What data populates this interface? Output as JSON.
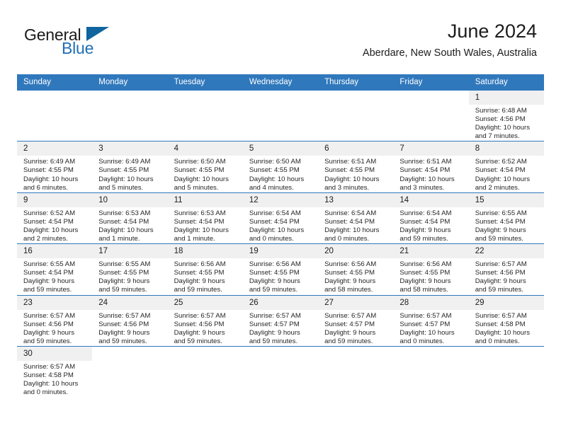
{
  "brand": {
    "name_top": "General",
    "name_bottom": "Blue",
    "accent_color": "#10659f",
    "blue_text_color": "#1f6fb5"
  },
  "header": {
    "title": "June 2024",
    "location": "Aberdare, New South Wales, Australia"
  },
  "theme": {
    "header_row_bg": "#3078bc",
    "day_number_bg": "#f0f0f0",
    "grid_line": "#7c7c7c",
    "week_divider": "#3078bc"
  },
  "weekdays": [
    "Sunday",
    "Monday",
    "Tuesday",
    "Wednesday",
    "Thursday",
    "Friday",
    "Saturday"
  ],
  "weeks": [
    [
      {
        "day": "",
        "empty": true
      },
      {
        "day": "",
        "empty": true
      },
      {
        "day": "",
        "empty": true
      },
      {
        "day": "",
        "empty": true
      },
      {
        "day": "",
        "empty": true
      },
      {
        "day": "",
        "empty": true
      },
      {
        "day": "1",
        "sunrise": "Sunrise: 6:48 AM",
        "sunset": "Sunset: 4:56 PM",
        "daylight1": "Daylight: 10 hours",
        "daylight2": "and 7 minutes."
      }
    ],
    [
      {
        "day": "2",
        "sunrise": "Sunrise: 6:49 AM",
        "sunset": "Sunset: 4:55 PM",
        "daylight1": "Daylight: 10 hours",
        "daylight2": "and 6 minutes."
      },
      {
        "day": "3",
        "sunrise": "Sunrise: 6:49 AM",
        "sunset": "Sunset: 4:55 PM",
        "daylight1": "Daylight: 10 hours",
        "daylight2": "and 5 minutes."
      },
      {
        "day": "4",
        "sunrise": "Sunrise: 6:50 AM",
        "sunset": "Sunset: 4:55 PM",
        "daylight1": "Daylight: 10 hours",
        "daylight2": "and 5 minutes."
      },
      {
        "day": "5",
        "sunrise": "Sunrise: 6:50 AM",
        "sunset": "Sunset: 4:55 PM",
        "daylight1": "Daylight: 10 hours",
        "daylight2": "and 4 minutes."
      },
      {
        "day": "6",
        "sunrise": "Sunrise: 6:51 AM",
        "sunset": "Sunset: 4:55 PM",
        "daylight1": "Daylight: 10 hours",
        "daylight2": "and 3 minutes."
      },
      {
        "day": "7",
        "sunrise": "Sunrise: 6:51 AM",
        "sunset": "Sunset: 4:54 PM",
        "daylight1": "Daylight: 10 hours",
        "daylight2": "and 3 minutes."
      },
      {
        "day": "8",
        "sunrise": "Sunrise: 6:52 AM",
        "sunset": "Sunset: 4:54 PM",
        "daylight1": "Daylight: 10 hours",
        "daylight2": "and 2 minutes."
      }
    ],
    [
      {
        "day": "9",
        "sunrise": "Sunrise: 6:52 AM",
        "sunset": "Sunset: 4:54 PM",
        "daylight1": "Daylight: 10 hours",
        "daylight2": "and 2 minutes."
      },
      {
        "day": "10",
        "sunrise": "Sunrise: 6:53 AM",
        "sunset": "Sunset: 4:54 PM",
        "daylight1": "Daylight: 10 hours",
        "daylight2": "and 1 minute."
      },
      {
        "day": "11",
        "sunrise": "Sunrise: 6:53 AM",
        "sunset": "Sunset: 4:54 PM",
        "daylight1": "Daylight: 10 hours",
        "daylight2": "and 1 minute."
      },
      {
        "day": "12",
        "sunrise": "Sunrise: 6:54 AM",
        "sunset": "Sunset: 4:54 PM",
        "daylight1": "Daylight: 10 hours",
        "daylight2": "and 0 minutes."
      },
      {
        "day": "13",
        "sunrise": "Sunrise: 6:54 AM",
        "sunset": "Sunset: 4:54 PM",
        "daylight1": "Daylight: 10 hours",
        "daylight2": "and 0 minutes."
      },
      {
        "day": "14",
        "sunrise": "Sunrise: 6:54 AM",
        "sunset": "Sunset: 4:54 PM",
        "daylight1": "Daylight: 9 hours",
        "daylight2": "and 59 minutes."
      },
      {
        "day": "15",
        "sunrise": "Sunrise: 6:55 AM",
        "sunset": "Sunset: 4:54 PM",
        "daylight1": "Daylight: 9 hours",
        "daylight2": "and 59 minutes."
      }
    ],
    [
      {
        "day": "16",
        "sunrise": "Sunrise: 6:55 AM",
        "sunset": "Sunset: 4:54 PM",
        "daylight1": "Daylight: 9 hours",
        "daylight2": "and 59 minutes."
      },
      {
        "day": "17",
        "sunrise": "Sunrise: 6:55 AM",
        "sunset": "Sunset: 4:55 PM",
        "daylight1": "Daylight: 9 hours",
        "daylight2": "and 59 minutes."
      },
      {
        "day": "18",
        "sunrise": "Sunrise: 6:56 AM",
        "sunset": "Sunset: 4:55 PM",
        "daylight1": "Daylight: 9 hours",
        "daylight2": "and 59 minutes."
      },
      {
        "day": "19",
        "sunrise": "Sunrise: 6:56 AM",
        "sunset": "Sunset: 4:55 PM",
        "daylight1": "Daylight: 9 hours",
        "daylight2": "and 59 minutes."
      },
      {
        "day": "20",
        "sunrise": "Sunrise: 6:56 AM",
        "sunset": "Sunset: 4:55 PM",
        "daylight1": "Daylight: 9 hours",
        "daylight2": "and 58 minutes."
      },
      {
        "day": "21",
        "sunrise": "Sunrise: 6:56 AM",
        "sunset": "Sunset: 4:55 PM",
        "daylight1": "Daylight: 9 hours",
        "daylight2": "and 58 minutes."
      },
      {
        "day": "22",
        "sunrise": "Sunrise: 6:57 AM",
        "sunset": "Sunset: 4:56 PM",
        "daylight1": "Daylight: 9 hours",
        "daylight2": "and 59 minutes."
      }
    ],
    [
      {
        "day": "23",
        "sunrise": "Sunrise: 6:57 AM",
        "sunset": "Sunset: 4:56 PM",
        "daylight1": "Daylight: 9 hours",
        "daylight2": "and 59 minutes."
      },
      {
        "day": "24",
        "sunrise": "Sunrise: 6:57 AM",
        "sunset": "Sunset: 4:56 PM",
        "daylight1": "Daylight: 9 hours",
        "daylight2": "and 59 minutes."
      },
      {
        "day": "25",
        "sunrise": "Sunrise: 6:57 AM",
        "sunset": "Sunset: 4:56 PM",
        "daylight1": "Daylight: 9 hours",
        "daylight2": "and 59 minutes."
      },
      {
        "day": "26",
        "sunrise": "Sunrise: 6:57 AM",
        "sunset": "Sunset: 4:57 PM",
        "daylight1": "Daylight: 9 hours",
        "daylight2": "and 59 minutes."
      },
      {
        "day": "27",
        "sunrise": "Sunrise: 6:57 AM",
        "sunset": "Sunset: 4:57 PM",
        "daylight1": "Daylight: 9 hours",
        "daylight2": "and 59 minutes."
      },
      {
        "day": "28",
        "sunrise": "Sunrise: 6:57 AM",
        "sunset": "Sunset: 4:57 PM",
        "daylight1": "Daylight: 10 hours",
        "daylight2": "and 0 minutes."
      },
      {
        "day": "29",
        "sunrise": "Sunrise: 6:57 AM",
        "sunset": "Sunset: 4:58 PM",
        "daylight1": "Daylight: 10 hours",
        "daylight2": "and 0 minutes."
      }
    ],
    [
      {
        "day": "30",
        "sunrise": "Sunrise: 6:57 AM",
        "sunset": "Sunset: 4:58 PM",
        "daylight1": "Daylight: 10 hours",
        "daylight2": "and 0 minutes."
      },
      {
        "day": "",
        "empty": true
      },
      {
        "day": "",
        "empty": true
      },
      {
        "day": "",
        "empty": true
      },
      {
        "day": "",
        "empty": true
      },
      {
        "day": "",
        "empty": true
      },
      {
        "day": "",
        "empty": true
      }
    ]
  ]
}
